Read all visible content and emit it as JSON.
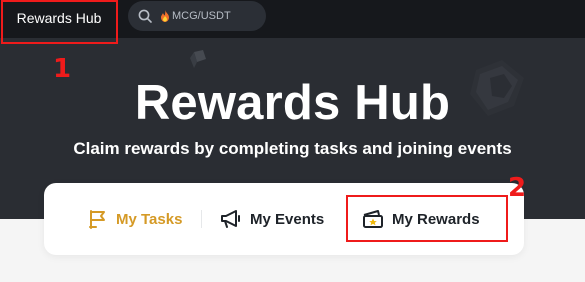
{
  "nav": {
    "title": "Rewards Hub",
    "search": {
      "icon": "search-icon",
      "prefix_icon": "fire-icon",
      "value": "MCG/USDT"
    }
  },
  "hero": {
    "title": "Rewards Hub",
    "subtitle": "Claim rewards by completing tasks and joining events"
  },
  "tabs": [
    {
      "label": "My Tasks",
      "icon": "flag-icon",
      "active": true
    },
    {
      "label": "My Events",
      "icon": "megaphone-icon",
      "active": false
    },
    {
      "label": "My Rewards",
      "icon": "ticket-icon",
      "active": false
    }
  ],
  "annotations": [
    {
      "number": "1"
    },
    {
      "number": "2"
    }
  ],
  "colors": {
    "accent": "#d59a26",
    "nav_bg": "#16181c",
    "hero_bg": "#2a2d33",
    "annotation": "#ef1b1b"
  }
}
